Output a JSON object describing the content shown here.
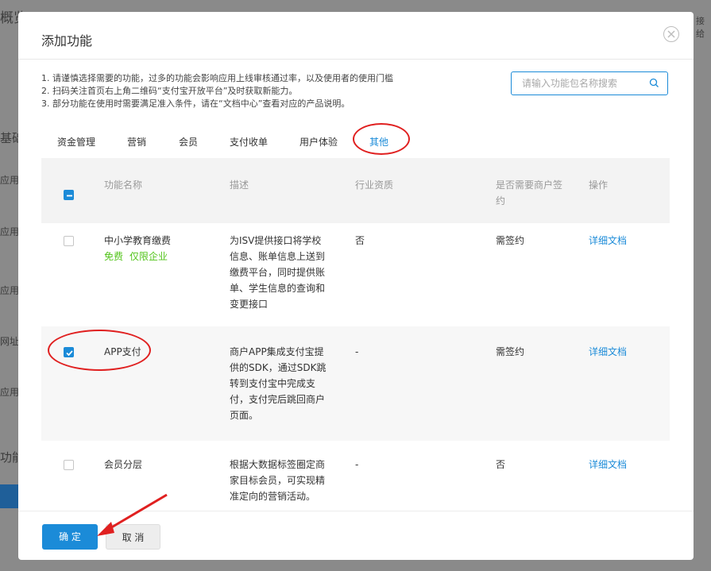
{
  "background": {
    "title_fragment": "概览",
    "side_labels": [
      "基础",
      "应用名",
      "应用图",
      "应用类",
      "网址u",
      "应用简",
      "功能"
    ],
    "top_right_fragment": "接给"
  },
  "dialog": {
    "title": "添加功能",
    "notes": [
      "1. 请谨慎选择需要的功能，过多的功能会影响应用上线审核通过率，以及使用者的使用门槛",
      "2. 扫码关注首页右上角二维码“支付宝开放平台”及时获取新能力。",
      "3. 部分功能在使用时需要满足准入条件，请在“文档中心”查看对应的产品说明。"
    ],
    "search": {
      "placeholder": "请输入功能包名称搜索",
      "value": ""
    },
    "tabs": [
      {
        "label": "资金管理",
        "active": false
      },
      {
        "label": "营销",
        "active": false
      },
      {
        "label": "会员",
        "active": false
      },
      {
        "label": "支付收单",
        "active": false
      },
      {
        "label": "用户体验",
        "active": false
      },
      {
        "label": "其他",
        "active": true
      }
    ],
    "table": {
      "headers": {
        "name": "功能名称",
        "desc": "描述",
        "qualification": "行业资质",
        "sign_line1": "是否需要商户签",
        "sign_line2": "约",
        "action": "操作"
      },
      "rows": [
        {
          "name": "中小学教育缴费",
          "tags": [
            "免费",
            "仅限企业"
          ],
          "desc_lines": [
            "为ISV提供接口将学校",
            "信息、账单信息上送到",
            "缴费平台，同时提供账",
            "单、学生信息的查询和",
            "变更接口"
          ],
          "qualification": "否",
          "sign": "需签约",
          "action": "详细文档",
          "checked": false
        },
        {
          "name": "APP支付",
          "tags": [],
          "desc_lines": [
            "商户APP集成支付宝提",
            "供的SDK，通过SDK跳",
            "转到支付宝中完成支",
            "付，支付完后跳回商户",
            "页面。"
          ],
          "qualification": "-",
          "sign": "需签约",
          "action": "详细文档",
          "checked": true
        },
        {
          "name": "会员分层",
          "tags": [],
          "desc_lines": [
            "根据大数据标签圈定商",
            "家目标会员，可实现精",
            "准定向的营销活动。"
          ],
          "qualification": "-",
          "sign": "否",
          "action": "详细文档",
          "checked": false
        }
      ]
    },
    "buttons": {
      "ok": "确 定",
      "cancel": "取 消"
    }
  },
  "colors": {
    "accent": "#1b8bd8",
    "annotation": "#e02020",
    "tag_green": "#52c41a"
  }
}
